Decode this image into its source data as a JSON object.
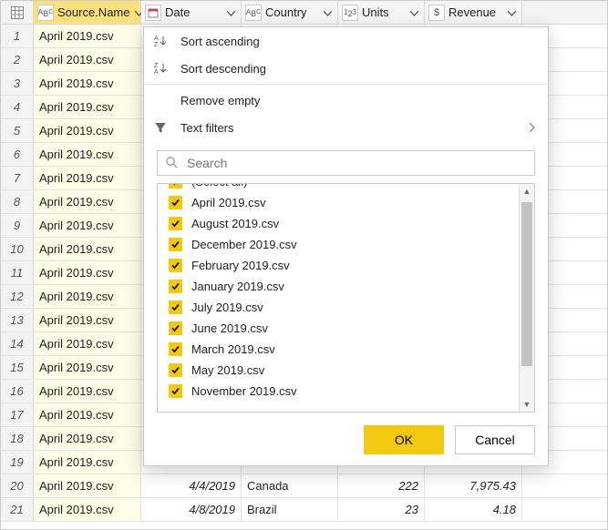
{
  "columns": {
    "source": "Source.Name",
    "date": "Date",
    "country": "Country",
    "units": "Units",
    "revenue": "Revenue"
  },
  "type_icons": {
    "text": "ABC",
    "date": "date",
    "num": "123",
    "currency": "$"
  },
  "rows": [
    {
      "n": 1,
      "src": "April 2019.csv",
      "date": "",
      "country": "",
      "units": "",
      "rev": ""
    },
    {
      "n": 2,
      "src": "April 2019.csv",
      "date": "",
      "country": "",
      "units": "",
      "rev": ""
    },
    {
      "n": 3,
      "src": "April 2019.csv",
      "date": "",
      "country": "",
      "units": "",
      "rev": ""
    },
    {
      "n": 4,
      "src": "April 2019.csv",
      "date": "",
      "country": "",
      "units": "",
      "rev": ""
    },
    {
      "n": 5,
      "src": "April 2019.csv",
      "date": "",
      "country": "",
      "units": "",
      "rev": ""
    },
    {
      "n": 6,
      "src": "April 2019.csv",
      "date": "",
      "country": "",
      "units": "",
      "rev": ""
    },
    {
      "n": 7,
      "src": "April 2019.csv",
      "date": "",
      "country": "",
      "units": "",
      "rev": ""
    },
    {
      "n": 8,
      "src": "April 2019.csv",
      "date": "",
      "country": "",
      "units": "",
      "rev": ""
    },
    {
      "n": 9,
      "src": "April 2019.csv",
      "date": "",
      "country": "",
      "units": "",
      "rev": ""
    },
    {
      "n": 10,
      "src": "April 2019.csv",
      "date": "",
      "country": "",
      "units": "",
      "rev": ""
    },
    {
      "n": 11,
      "src": "April 2019.csv",
      "date": "",
      "country": "",
      "units": "",
      "rev": ""
    },
    {
      "n": 12,
      "src": "April 2019.csv",
      "date": "",
      "country": "",
      "units": "",
      "rev": ""
    },
    {
      "n": 13,
      "src": "April 2019.csv",
      "date": "",
      "country": "",
      "units": "",
      "rev": ""
    },
    {
      "n": 14,
      "src": "April 2019.csv",
      "date": "",
      "country": "",
      "units": "",
      "rev": ""
    },
    {
      "n": 15,
      "src": "April 2019.csv",
      "date": "",
      "country": "",
      "units": "",
      "rev": ""
    },
    {
      "n": 16,
      "src": "April 2019.csv",
      "date": "",
      "country": "",
      "units": "",
      "rev": ""
    },
    {
      "n": 17,
      "src": "April 2019.csv",
      "date": "",
      "country": "",
      "units": "",
      "rev": ""
    },
    {
      "n": 18,
      "src": "April 2019.csv",
      "date": "",
      "country": "",
      "units": "",
      "rev": ""
    },
    {
      "n": 19,
      "src": "April 2019.csv",
      "date": "",
      "country": "",
      "units": "",
      "rev": ""
    },
    {
      "n": 20,
      "src": "April 2019.csv",
      "date": "4/4/2019",
      "country": "Canada",
      "units": "222",
      "rev": "7,975.43"
    },
    {
      "n": 21,
      "src": "April 2019.csv",
      "date": "4/8/2019",
      "country": "Brazil",
      "units": "23",
      "rev": "4.18"
    }
  ],
  "menu": {
    "sort_asc": "Sort ascending",
    "sort_desc": "Sort descending",
    "remove_empty": "Remove empty",
    "text_filters": "Text filters",
    "search_placeholder": "Search",
    "ok": "OK",
    "cancel": "Cancel",
    "items": [
      "(Select all)",
      "April 2019.csv",
      "August 2019.csv",
      "December 2019.csv",
      "February 2019.csv",
      "January 2019.csv",
      "July 2019.csv",
      "June 2019.csv",
      "March 2019.csv",
      "May 2019.csv",
      "November 2019.csv"
    ]
  }
}
